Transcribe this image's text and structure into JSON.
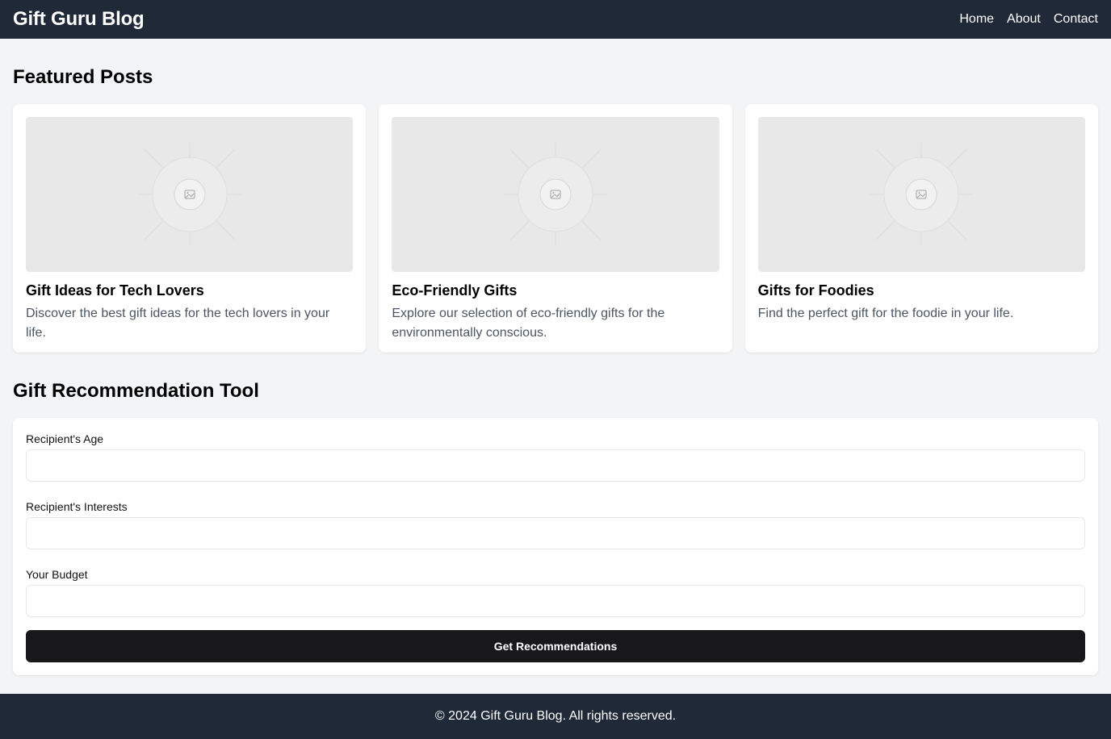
{
  "header": {
    "brand": "Gift Guru Blog",
    "nav": [
      "Home",
      "About",
      "Contact"
    ]
  },
  "featured": {
    "title": "Featured Posts",
    "posts": [
      {
        "title": "Gift Ideas for Tech Lovers",
        "description": "Discover the best gift ideas for the tech lovers in your life.",
        "image_icon": "image-placeholder-icon"
      },
      {
        "title": "Eco-Friendly Gifts",
        "description": "Explore our selection of eco-friendly gifts for the environmentally conscious.",
        "image_icon": "image-placeholder-icon"
      },
      {
        "title": "Gifts for Foodies",
        "description": "Find the perfect gift for the foodie in your life.",
        "image_icon": "image-placeholder-icon"
      }
    ]
  },
  "tool": {
    "title": "Gift Recommendation Tool",
    "fields": [
      {
        "label": "Recipient's Age",
        "value": ""
      },
      {
        "label": "Recipient's Interests",
        "value": ""
      },
      {
        "label": "Your Budget",
        "value": ""
      }
    ],
    "submit_label": "Get Recommendations"
  },
  "footer": {
    "copyright": "© 2024 Gift Guru Blog. All rights reserved."
  },
  "colors": {
    "header_bg": "#1f2937",
    "page_bg": "#f3f4f6",
    "button_bg": "#18181b",
    "placeholder_bg": "#e8e8e8"
  }
}
